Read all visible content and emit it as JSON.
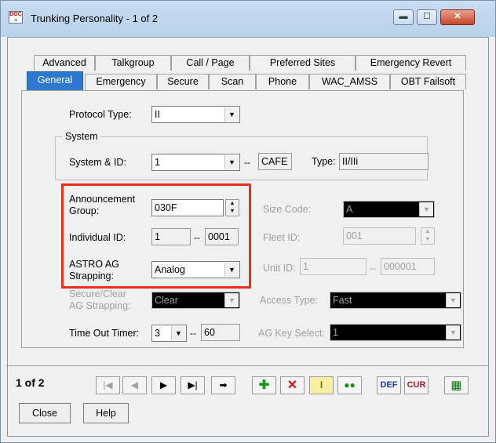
{
  "window": {
    "title": "Trunking Personality - 1 of 2",
    "app_icon": "doc-icon",
    "controls": {
      "minimize": "▬",
      "maximize": "☐",
      "close": "✕"
    }
  },
  "tabs_row1": [
    "Advanced",
    "Talkgroup",
    "Call / Page",
    "Preferred Sites",
    "Emergency Revert"
  ],
  "tabs_row2": [
    "General",
    "Emergency",
    "Secure",
    "Scan",
    "Phone",
    "WAC_AMSS",
    "OBT Failsoft"
  ],
  "active_tab": "General",
  "form": {
    "protocol_type": {
      "label": "Protocol Type:",
      "value": "II"
    },
    "system": {
      "group_label": "System",
      "label": "System & ID:",
      "value": "1",
      "id_value": "CAFE",
      "type_label": "Type:",
      "type_value": "II/IIi"
    },
    "announcement_group": {
      "label_line1": "Announcement",
      "label_line2": "Group:",
      "value": "030F"
    },
    "individual_id": {
      "label": "Individual ID:",
      "value1": "1",
      "value2": "0001"
    },
    "astro_ag_strapping": {
      "label_line1": "ASTRO AG",
      "label_line2": "Strapping:",
      "value": "Analog"
    },
    "secure_clear_ag_strapping": {
      "label_line1": "Secure/Clear",
      "label_line2": "AG Strapping:",
      "value": "Clear"
    },
    "time_out_timer": {
      "label": "Time Out Timer:",
      "value": "3",
      "seconds": "60"
    },
    "size_code": {
      "label": "Size Code:",
      "value": "A"
    },
    "fleet_id": {
      "label": "Fleet ID:",
      "value": "001"
    },
    "unit_id": {
      "label": "Unit ID:",
      "value1": "1",
      "value2": "000001"
    },
    "access_type": {
      "label": "Access Type:",
      "value": "Fast"
    },
    "ag_key_select": {
      "label": "AG Key Select:",
      "value": "1"
    },
    "separator": "--"
  },
  "toolbar": {
    "counter": "1 of 2",
    "def_label": "DEF",
    "cur_label": "CUR"
  },
  "buttons": {
    "close": "Close",
    "help": "Help"
  },
  "colors": {
    "highlight_box": "#e8301c",
    "active_tab": "#2c79cf"
  }
}
